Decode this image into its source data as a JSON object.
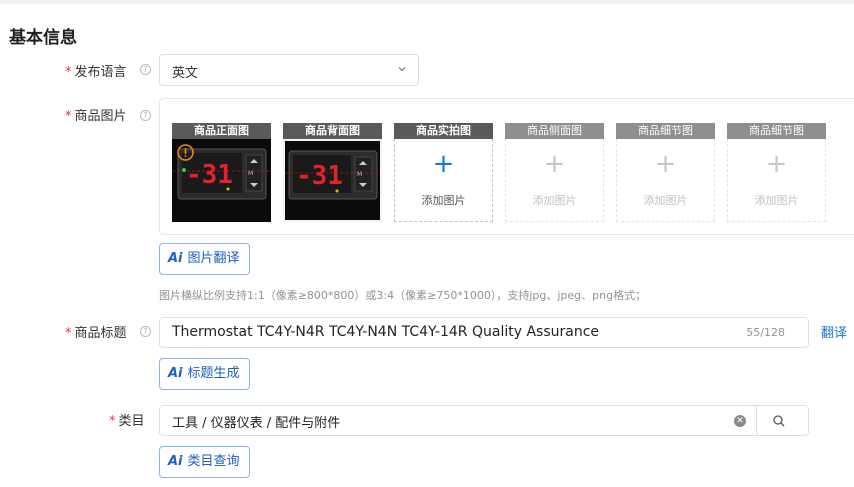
{
  "section": {
    "title": "基本信息"
  },
  "language": {
    "label": "发布语言",
    "value": "英文",
    "required_mark": "*"
  },
  "images": {
    "label": "商品图片",
    "required_mark": "*",
    "slots": [
      {
        "title": "商品正面图",
        "state": "filled"
      },
      {
        "title": "商品背面图",
        "state": "filled"
      },
      {
        "title": "商品实拍图",
        "state": "empty",
        "add_text": "添加图片"
      },
      {
        "title": "商品侧面图",
        "state": "disabled",
        "add_text": "添加图片"
      },
      {
        "title": "商品细节图",
        "state": "disabled",
        "add_text": "添加图片"
      },
      {
        "title": "商品细节图",
        "state": "disabled",
        "add_text": "添加图片"
      }
    ],
    "plus_glyph": "+",
    "ai_button": {
      "prefix": "Ai",
      "label": "图片翻译"
    },
    "hint": "图片横纵比例支持1:1（像素≥800*800）或3:4（像素≥750*1000），支持jpg、jpeg、png格式；"
  },
  "title_field": {
    "label": "商品标题",
    "required_mark": "*",
    "value": "Thermostat TC4Y-N4R TC4Y-N4N TC4Y-14R Quality Assurance",
    "count": "55/128",
    "translate_link": "翻译",
    "ai_button": {
      "prefix": "Ai",
      "label": "标题生成"
    }
  },
  "category": {
    "label": "类目",
    "required_mark": "*",
    "value": "工具 / 仪器仪表 / 配件与附件",
    "ai_button": {
      "prefix": "Ai",
      "label": "类目查询"
    }
  },
  "icons": {
    "help": "question-circle-icon",
    "chevron": "chevron-down-icon",
    "clear": "clear-circle-icon",
    "search": "search-icon",
    "warning": "warning-circle-icon"
  },
  "colors": {
    "required": "#e4393c",
    "accent": "#1677d2",
    "ai_button": "#1e5fbf"
  }
}
